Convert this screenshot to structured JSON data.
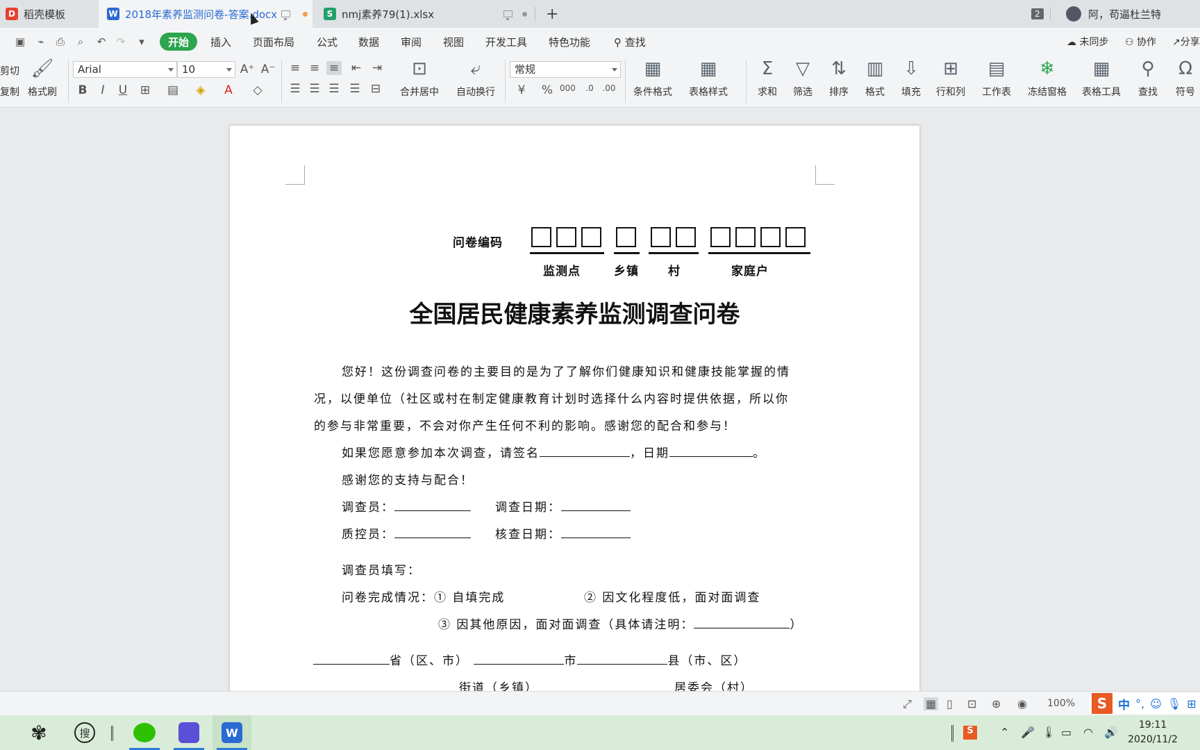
{
  "tabs": [
    {
      "label": "稻壳模板",
      "icon": "docer-icon"
    },
    {
      "label": "2018年素养监测问卷-答案.docx",
      "icon": "word-icon"
    },
    {
      "label": "nmj素养79(1).xlsx",
      "icon": "sheet-icon"
    }
  ],
  "window": {
    "badge": "2",
    "user": "阿，苟逼杜兰特"
  },
  "menu": {
    "start": "开始",
    "items": [
      "插入",
      "页面布局",
      "公式",
      "数据",
      "审阅",
      "视图",
      "开发工具",
      "特色功能"
    ],
    "search": "查找",
    "unsynced": "未同步",
    "collab": "协作",
    "share": "分享"
  },
  "ribbon": {
    "cut": "剪切",
    "copy": "复制",
    "format_painter": "格式刷",
    "font_name": "Arial",
    "font_size": "10",
    "merge_center": "合并居中",
    "wrap": "自动换行",
    "number_format": "常规",
    "conditional": "条件格式",
    "table_style": "表格样式",
    "sum": "求和",
    "filter": "筛选",
    "sort": "排序",
    "format": "格式",
    "fill": "填充",
    "rowcol": "行和列",
    "worksheet": "工作表",
    "freeze": "冻结窗格",
    "table_tools": "表格工具",
    "find": "查找",
    "symbol": "符号"
  },
  "doc": {
    "code_label": "问卷编码",
    "code_groups": [
      "监测点",
      "乡镇",
      "村",
      "家庭户"
    ],
    "title": "全国居民健康素养监测调查问卷",
    "intro_1": "您好！这份调查问卷的主要目的是为了了解你们健康知识和健康技能掌握的情",
    "intro_2": "况，以便单位（社区或村在制定健康教育计划时选择什么内容时提供依据，所以你",
    "intro_3": "的参与非常重要，不会对你产生任何不利的影响。感谢您的配合和参与！",
    "sign_prefix": "如果您愿意参加本次调查，请签名",
    "sign_date": "，日期",
    "sign_end": "。",
    "thanks": "感谢您的支持与配合！",
    "investigator": "调查员：",
    "investigate_date": "调查日期：",
    "qc": "质控员：",
    "check_date": "核查日期：",
    "fill_by": "调查员填写：",
    "completion": "问卷完成情况：",
    "opt1_num": "①",
    "opt1": "自填完成",
    "opt2_num": "②",
    "opt2": "因文化程度低，面对面调查",
    "opt3_num": "③",
    "opt3": "因其他原因，面对面调查（具体请注明：",
    "opt3_end": "）",
    "province": "省（区、市）",
    "city": "市",
    "county": "县（市、区）",
    "street": "街道（乡镇）",
    "committee": "居委会（村）"
  },
  "status": {
    "zoom": "100%",
    "ime_mode": "中"
  },
  "taskbar": {
    "time": "19:11",
    "date": "2020/11/2"
  },
  "colors": {
    "accent_green": "#2da44e",
    "active_tab_text": "#2b6ad1",
    "taskbar_bg": "#d9ecd9"
  }
}
